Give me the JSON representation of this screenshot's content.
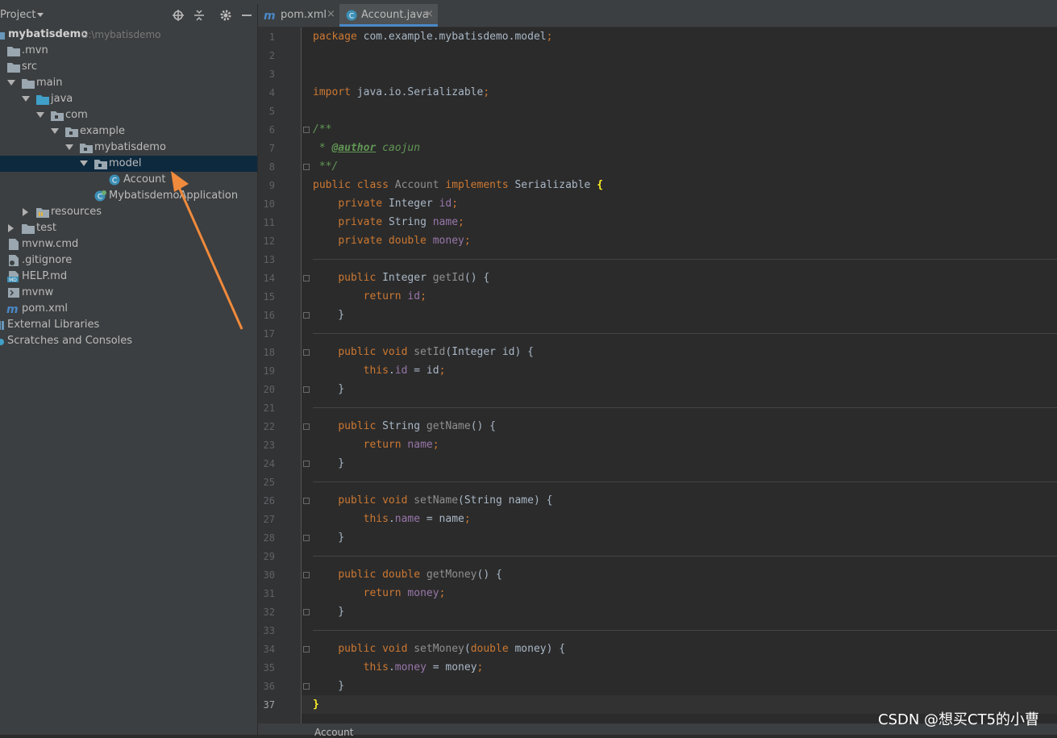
{
  "project_panel": {
    "title": "Project",
    "icons": [
      "locate-icon",
      "collapse-icon",
      "gear-icon",
      "minimize-icon"
    ],
    "tree": [
      {
        "label": "mybatisdemo",
        "path": "G:\\mybatisdemo",
        "icon": "module-icon",
        "bold": true
      },
      {
        "label": ".mvn",
        "icon": "folder-icon"
      },
      {
        "label": "src",
        "icon": "folder-icon"
      },
      {
        "label": "main",
        "icon": "folder-icon"
      },
      {
        "label": "java",
        "icon": "source-folder-icon"
      },
      {
        "label": "com",
        "icon": "package-icon"
      },
      {
        "label": "example",
        "icon": "package-icon"
      },
      {
        "label": "mybatisdemo",
        "icon": "package-icon"
      },
      {
        "label": "model",
        "icon": "package-icon",
        "selected": true
      },
      {
        "label": "Account",
        "icon": "class-icon"
      },
      {
        "label": "MybatisdemoApplication",
        "icon": "spring-class-icon"
      },
      {
        "label": "resources",
        "icon": "resources-folder-icon"
      },
      {
        "label": "test",
        "icon": "folder-icon"
      },
      {
        "label": "mvnw.cmd",
        "icon": "file-icon"
      },
      {
        "label": ".gitignore",
        "icon": "gitignore-icon"
      },
      {
        "label": "HELP.md",
        "icon": "markdown-icon"
      },
      {
        "label": "mvnw",
        "icon": "shell-icon"
      },
      {
        "label": "pom.xml",
        "icon": "maven-icon"
      },
      {
        "label": "External Libraries",
        "icon": "library-icon"
      },
      {
        "label": "Scratches and Consoles",
        "icon": "scratches-icon"
      }
    ]
  },
  "tabs": [
    {
      "label": "pom.xml",
      "icon": "maven-icon",
      "active": false
    },
    {
      "label": "Account.java",
      "icon": "class-icon",
      "active": true
    }
  ],
  "tab_close_glyph": "×",
  "editor": {
    "current_line": 37,
    "line_numbers": [
      "1",
      "2",
      "3",
      "4",
      "5",
      "6",
      "7",
      "8",
      "9",
      "10",
      "11",
      "12",
      "13",
      "14",
      "15",
      "16",
      "17",
      "18",
      "19",
      "20",
      "21",
      "22",
      "23",
      "24",
      "25",
      "26",
      "27",
      "28",
      "29",
      "30",
      "31",
      "32",
      "33",
      "34",
      "35",
      "36",
      "37"
    ],
    "lines": [
      [
        {
          "t": "package",
          "c": "kw"
        },
        {
          "t": " com.example.mybatisdemo.model"
        },
        {
          "t": ";",
          "c": "kw"
        }
      ],
      [],
      [],
      [
        {
          "t": "import",
          "c": "kw"
        },
        {
          "t": " java.io.Serializable"
        },
        {
          "t": ";",
          "c": "kw"
        }
      ],
      [],
      [
        {
          "t": "/**",
          "c": "cm"
        }
      ],
      [
        {
          "t": " * ",
          "c": "cm"
        },
        {
          "t": "@author",
          "c": "tag"
        },
        {
          "t": " caojun",
          "c": "cm"
        }
      ],
      [
        {
          "t": " **/",
          "c": "cm"
        }
      ],
      [
        {
          "t": "public class ",
          "c": "kw"
        },
        {
          "t": "Account ",
          "c": "dim"
        },
        {
          "t": "implements ",
          "c": "kw"
        },
        {
          "t": "Serializable "
        },
        {
          "t": "{",
          "c": "br"
        }
      ],
      [
        {
          "t": "    "
        },
        {
          "t": "private ",
          "c": "kw"
        },
        {
          "t": "Integer "
        },
        {
          "t": "id",
          "c": "fld"
        },
        {
          "t": ";",
          "c": "kw"
        }
      ],
      [
        {
          "t": "    "
        },
        {
          "t": "private ",
          "c": "kw"
        },
        {
          "t": "String "
        },
        {
          "t": "name",
          "c": "fld"
        },
        {
          "t": ";",
          "c": "kw"
        }
      ],
      [
        {
          "t": "    "
        },
        {
          "t": "private double ",
          "c": "kw"
        },
        {
          "t": "money",
          "c": "fld"
        },
        {
          "t": ";",
          "c": "kw"
        }
      ],
      [],
      [
        {
          "t": "    "
        },
        {
          "t": "public ",
          "c": "kw"
        },
        {
          "t": "Integer "
        },
        {
          "t": "getId",
          "c": "dim"
        },
        {
          "t": "() {"
        }
      ],
      [
        {
          "t": "        "
        },
        {
          "t": "return ",
          "c": "kw"
        },
        {
          "t": "id",
          "c": "fld"
        },
        {
          "t": ";",
          "c": "kw"
        }
      ],
      [
        {
          "t": "    }"
        }
      ],
      [],
      [
        {
          "t": "    "
        },
        {
          "t": "public void ",
          "c": "kw"
        },
        {
          "t": "setId",
          "c": "dim"
        },
        {
          "t": "(Integer id) {"
        }
      ],
      [
        {
          "t": "        "
        },
        {
          "t": "this",
          "c": "kw"
        },
        {
          "t": "."
        },
        {
          "t": "id",
          "c": "fld"
        },
        {
          "t": " = id"
        },
        {
          "t": ";",
          "c": "kw"
        }
      ],
      [
        {
          "t": "    }"
        }
      ],
      [],
      [
        {
          "t": "    "
        },
        {
          "t": "public ",
          "c": "kw"
        },
        {
          "t": "String "
        },
        {
          "t": "getName",
          "c": "dim"
        },
        {
          "t": "() {"
        }
      ],
      [
        {
          "t": "        "
        },
        {
          "t": "return ",
          "c": "kw"
        },
        {
          "t": "name",
          "c": "fld"
        },
        {
          "t": ";",
          "c": "kw"
        }
      ],
      [
        {
          "t": "    }"
        }
      ],
      [],
      [
        {
          "t": "    "
        },
        {
          "t": "public void ",
          "c": "kw"
        },
        {
          "t": "setName",
          "c": "dim"
        },
        {
          "t": "(String name) {"
        }
      ],
      [
        {
          "t": "        "
        },
        {
          "t": "this",
          "c": "kw"
        },
        {
          "t": "."
        },
        {
          "t": "name",
          "c": "fld"
        },
        {
          "t": " = name"
        },
        {
          "t": ";",
          "c": "kw"
        }
      ],
      [
        {
          "t": "    }"
        }
      ],
      [],
      [
        {
          "t": "    "
        },
        {
          "t": "public double ",
          "c": "kw"
        },
        {
          "t": "getMoney",
          "c": "dim"
        },
        {
          "t": "() {"
        }
      ],
      [
        {
          "t": "        "
        },
        {
          "t": "return ",
          "c": "kw"
        },
        {
          "t": "money",
          "c": "fld"
        },
        {
          "t": ";",
          "c": "kw"
        }
      ],
      [
        {
          "t": "    }"
        }
      ],
      [],
      [
        {
          "t": "    "
        },
        {
          "t": "public void ",
          "c": "kw"
        },
        {
          "t": "setMoney",
          "c": "dim"
        },
        {
          "t": "("
        },
        {
          "t": "double ",
          "c": "kw"
        },
        {
          "t": "money) {"
        }
      ],
      [
        {
          "t": "        "
        },
        {
          "t": "this",
          "c": "kw"
        },
        {
          "t": "."
        },
        {
          "t": "money",
          "c": "fld"
        },
        {
          "t": " = money"
        },
        {
          "t": ";",
          "c": "kw"
        }
      ],
      [
        {
          "t": "    }"
        }
      ],
      [
        {
          "t": "}",
          "c": "br"
        }
      ]
    ]
  },
  "status_bar": {
    "breadcrumb": "Account"
  },
  "watermark": "CSDN @想买CT5的小曹",
  "colors": {
    "selection": "#0d293e",
    "annotation_arrow": "#f08a3c",
    "tab_underline": "#4a88c7"
  }
}
